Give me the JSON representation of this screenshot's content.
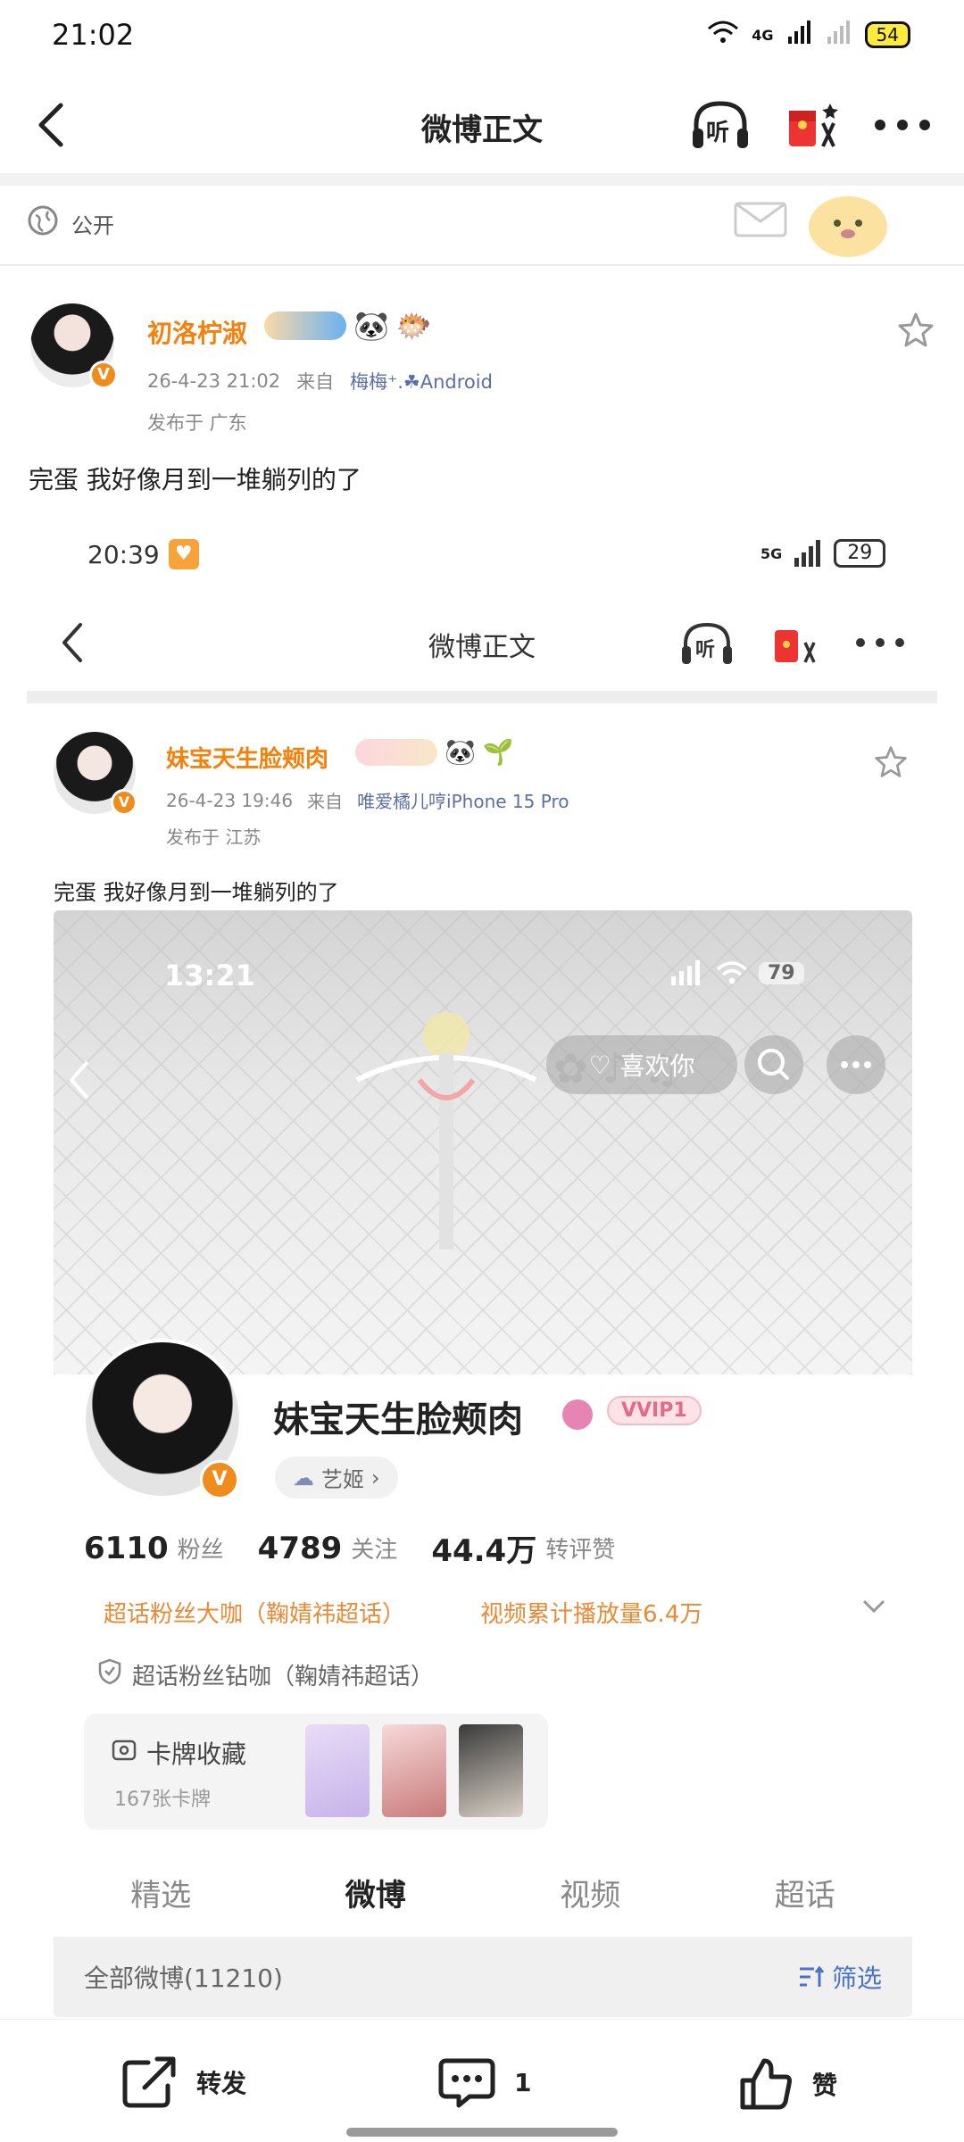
{
  "status_bar": {
    "time": "21:02",
    "network": "4G",
    "battery": "54"
  },
  "nav": {
    "title": "微博正文",
    "listen_label": "听"
  },
  "visibility": {
    "label": "公开"
  },
  "post": {
    "author": "初洛柠淑",
    "date": "26-4-23  21:02",
    "source_prefix": "来自",
    "source": "梅梅⁺.☘Android",
    "location": "发布于  广东",
    "text": "完蛋  我好像月到一堆躺列的了"
  },
  "embedded": {
    "status_time": "20:39",
    "status_battery": "29",
    "network": "5G",
    "nav_title": "微博正文",
    "listen_label": "听",
    "author": "妹宝天生脸颊肉",
    "date": "26-4-23  19:46",
    "source_prefix": "来自",
    "source": "唯爱橘儿哼iPhone 15 Pro",
    "location": "发布于  江苏",
    "text": "完蛋 我好像月到一堆躺列的了"
  },
  "profile": {
    "status_time": "13:21",
    "battery": "79",
    "like_button": "喜欢你",
    "name": "妹宝天生脸颊肉",
    "vip_label": "VVIP1",
    "tag": "艺姬",
    "fans_num": "6110",
    "fans_lbl": "粉丝",
    "follow_num": "4789",
    "follow_lbl": "关注",
    "zan_num": "44.4万",
    "zan_lbl": "转评赞",
    "super_tag": "超话粉丝大咖（鞠婧祎超话）",
    "video_tag": "视频累计播放量6.4万",
    "diamond": "超话粉丝钻咖（鞠婧祎超话）",
    "card_title": "卡牌收藏",
    "card_count": "167张卡牌",
    "tabs": [
      "精选",
      "微博",
      "视频",
      "超话"
    ],
    "all_posts": "全部微博(11210)",
    "filter": "筛选"
  },
  "bottom_bar": {
    "repost": "转发",
    "comment_count": "1",
    "like": "赞"
  },
  "colors": {
    "accent_orange": "#f5800b",
    "source_blue": "#5b6fa5",
    "link_blue": "#4a73c8"
  }
}
